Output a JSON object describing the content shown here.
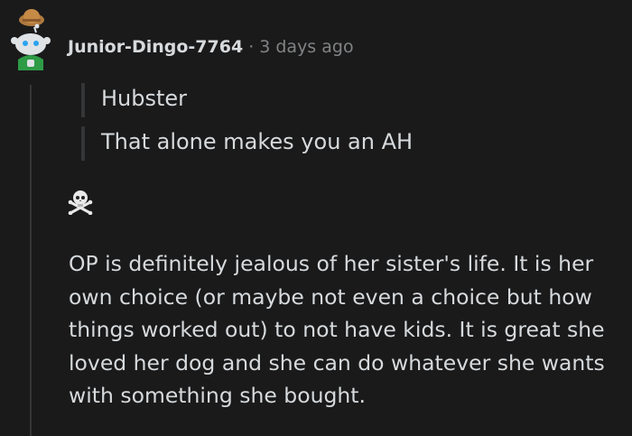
{
  "comment": {
    "username": "Junior-Dingo-7764",
    "separator": "·",
    "timestamp": "3 days ago",
    "quotes": [
      "Hubster",
      "That alone makes you an AH"
    ],
    "emoji_icon": "skull-crossbones-icon",
    "body": "OP is definitely jealous of her sister's life. It is her own choice (or maybe not even a choice but how things worked out) to not have kids. It is great she loved her dog and she can do whatever she wants with something she bought."
  }
}
